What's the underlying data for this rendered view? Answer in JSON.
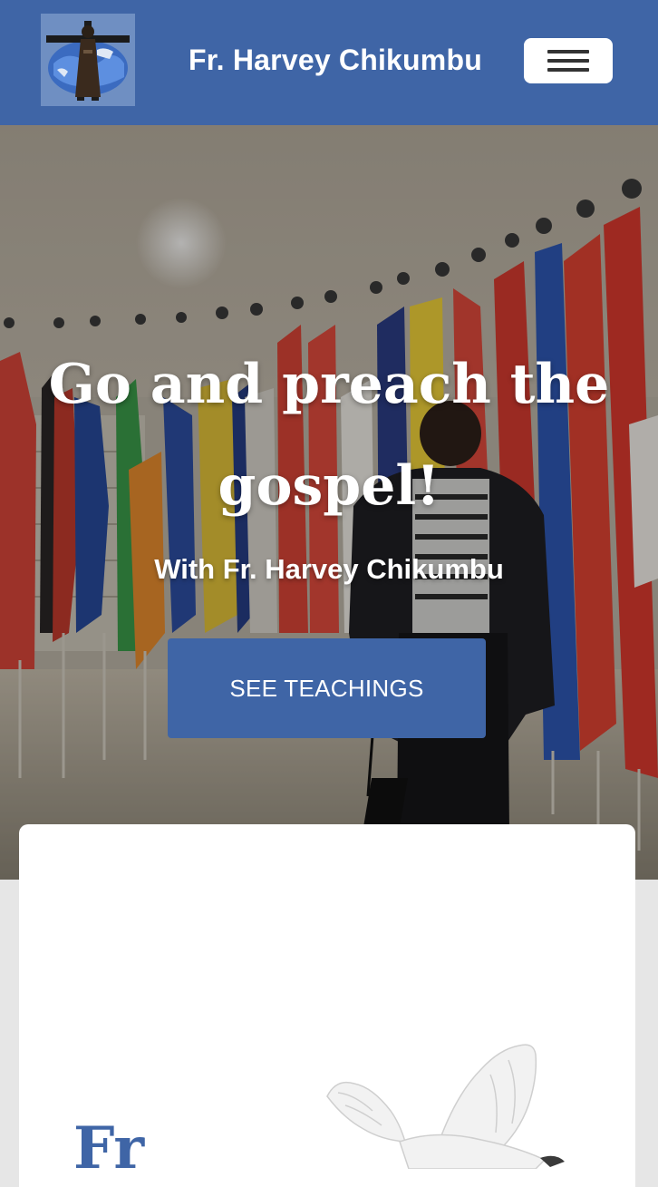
{
  "navbar": {
    "brand_name": "Fr. Harvey Chikumbu",
    "logo_icon": "franciscan-cross-globe-icon",
    "menu_icon": "hamburger-menu-icon",
    "background_color": "#3f65a6"
  },
  "hero": {
    "heading": "Go and preach the gospel!",
    "subheading": "With Fr. Harvey Chikumbu",
    "cta_label": "SEE TEACHINGS",
    "accent_color": "#3f65a6"
  },
  "card": {
    "heading_partial": "Fr",
    "image_icon": "dove-icon"
  }
}
